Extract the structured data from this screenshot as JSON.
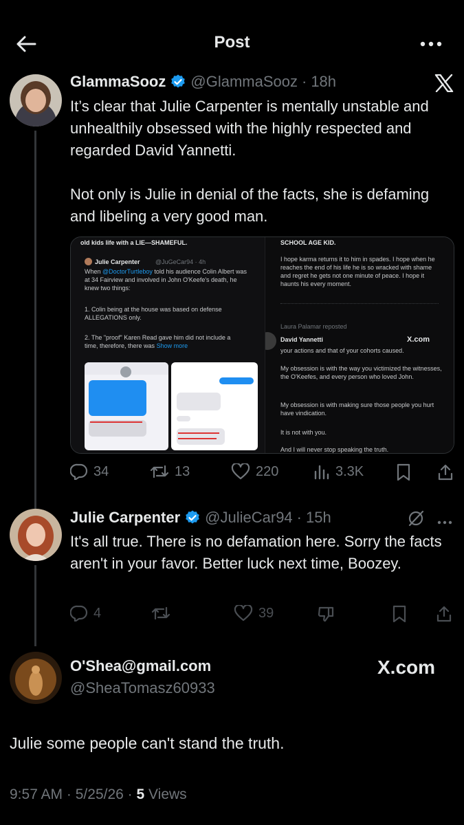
{
  "header": {
    "title": "Post"
  },
  "tweet1": {
    "display_name": "GlammaSooz",
    "handle": "@GlammaSooz",
    "dot": "·",
    "time": "18h",
    "text": "It’s clear that Julie Carpenter is mentally unstable and unhealthily obsessed with the highly respected and regarded David Yannetti.\n\nNot only is Julie in denial of the facts, she is defaming and libeling a very good man.",
    "stats": {
      "replies": "34",
      "reposts": "13",
      "likes": "220",
      "views": "3.3K"
    },
    "media": {
      "left_top_line": "old kids life with a LIE—SHAMEFUL.",
      "left_name": "Julie Carpenter",
      "left_handle": "@JuGeCar94 · 4h",
      "left_body_1": "When",
      "left_body_mention": "@DoctorTurtleboy",
      "left_body_2": "told his audience Colin Albert was at 34 Fairview and involved in John O'Keefe's death, he knew two things:",
      "left_point_1": "1. Colin being at the house was based on defense ALLEGATIONS only.",
      "left_point_2": "2. The \"proof\" Karen Read gave him did not include a time, therefore, there was",
      "left_show_more": "Show more",
      "right_top_line": "SCHOOL AGE KID.",
      "right_body_1": "I hope karma returns it to him in spades. I hope when he reaches the end of his life he is so wracked with shame and regret he gets not one minute of peace. I hope it haunts his every moment.",
      "right_reposted": "Laura Palamar reposted",
      "right_name": "David Yannetti",
      "right_xcom": "X.com",
      "right_body_2": "your actions and that of your cohorts caused.",
      "right_body_3": "My obsession is with the way you victimized the witnesses, the O'Keefes, and every person who loved John.",
      "right_body_4": "My obsession is with making sure those people you hurt have vindication.",
      "right_body_5": "It is not with you.",
      "right_body_6": "And I will never stop speaking the truth."
    }
  },
  "tweet2": {
    "display_name": "Julie Carpenter",
    "handle": "@JulieCar94",
    "dot": "·",
    "time": "15h",
    "text": "It's all true. There is no defamation here. Sorry the facts aren't in your favor. Better luck next time, Boozey.",
    "stats": {
      "replies": "4",
      "likes": "39"
    }
  },
  "reply": {
    "display_name": "O'Shea@gmail.com",
    "handle": "@SheaTomasz60933",
    "brand": "X.com",
    "text": "Julie some people can't stand the truth.",
    "time": "9:57 AM",
    "date": "5/25/26",
    "views_count": "5",
    "views_label": "Views",
    "sep": "·"
  },
  "colors": {
    "background": "#000000",
    "text": "#e7e9ea",
    "muted": "#71767b",
    "verified": "#1d9bf0"
  }
}
